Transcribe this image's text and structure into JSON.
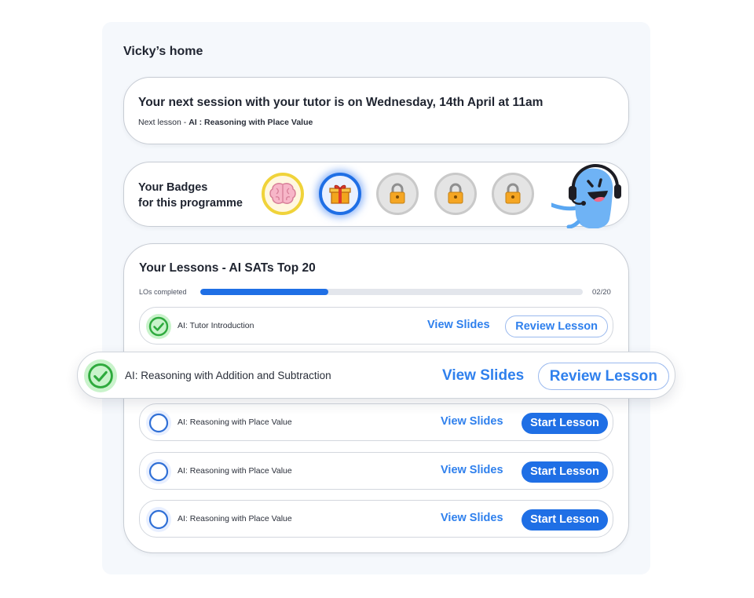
{
  "home": {
    "title": "Vicky’s home"
  },
  "session": {
    "text": "Your next session with your tutor is on Wednesday, 14th April at 11am",
    "next_label": "Next lesson - ",
    "next_lesson": "AI : Reasoning with Place Value"
  },
  "badges": {
    "title_line1": "Your Badges",
    "title_line2": "for this programme",
    "items": [
      {
        "icon": "brain-icon",
        "state": "earned",
        "color": "#f0d33a"
      },
      {
        "icon": "gift-icon",
        "state": "current",
        "color": "#1f6fe5"
      },
      {
        "icon": "lock-icon",
        "state": "locked"
      },
      {
        "icon": "lock-icon",
        "state": "locked"
      },
      {
        "icon": "lock-icon",
        "state": "locked"
      }
    ]
  },
  "lessons": {
    "title": "Your Lessons - AI SATs Top 20",
    "progress_label": "LOs completed",
    "progress_text": "02/20",
    "progress_fraction": 0.335,
    "rows": [
      {
        "label": "AI: Tutor Introduction",
        "status": "completed",
        "view": "View Slides",
        "action": "Review Lesson"
      },
      {
        "label": "AI: Reasoning with Addition and Subtraction",
        "status": "completed",
        "view": "View Slides",
        "action": "Review Lesson"
      },
      {
        "label": "AI: Reasoning with Place Value",
        "status": "not-started",
        "view": "View Slides",
        "action": "Start Lesson"
      },
      {
        "label": "AI: Reasoning with Place Value",
        "status": "not-started",
        "view": "View Slides",
        "action": "Start Lesson"
      },
      {
        "label": "AI: Reasoning with Place Value",
        "status": "not-started",
        "view": "View Slides",
        "action": "Start Lesson"
      }
    ]
  },
  "colors": {
    "accent": "#1f6fe5",
    "link": "#2f80ed",
    "success": "#2eaa3d",
    "success_bg": "#c9f3cb",
    "badge_gold": "#f0d33a"
  }
}
